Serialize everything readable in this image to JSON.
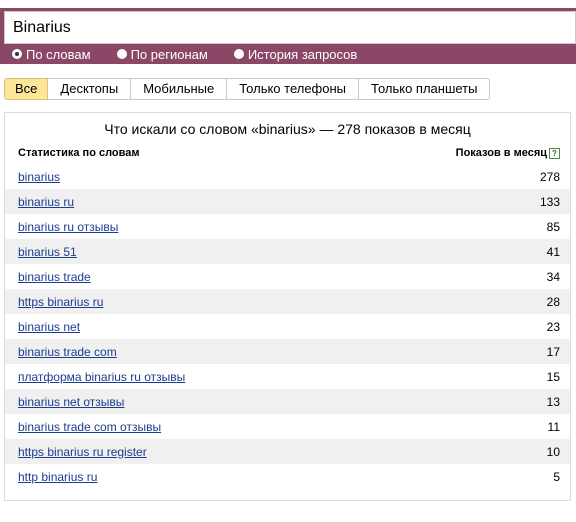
{
  "search": {
    "value": "Binarius"
  },
  "modes": [
    {
      "label": "По словам",
      "checked": true
    },
    {
      "label": "По регионам",
      "checked": false
    },
    {
      "label": "История запросов",
      "checked": false
    }
  ],
  "tabs": [
    "Все",
    "Десктопы",
    "Мобильные",
    "Только телефоны",
    "Только планшеты"
  ],
  "active_tab": "Все",
  "panel": {
    "title": "Что искали со словом «binarius» — 278 показов в месяц",
    "col_left": "Статистика по словам",
    "col_right": "Показов в месяц",
    "help": "?"
  },
  "rows": [
    {
      "phrase": "binarius",
      "count": "278"
    },
    {
      "phrase": "binarius ru",
      "count": "133"
    },
    {
      "phrase": "binarius ru отзывы",
      "count": "85"
    },
    {
      "phrase": "binarius 51",
      "count": "41"
    },
    {
      "phrase": "binarius trade",
      "count": "34"
    },
    {
      "phrase": "https binarius ru",
      "count": "28"
    },
    {
      "phrase": "binarius net",
      "count": "23"
    },
    {
      "phrase": "binarius trade com",
      "count": "17"
    },
    {
      "phrase": "платформа binarius ru отзывы",
      "count": "15"
    },
    {
      "phrase": "binarius net отзывы",
      "count": "13"
    },
    {
      "phrase": "binarius trade com отзывы",
      "count": "11"
    },
    {
      "phrase": "https binarius ru register",
      "count": "10"
    },
    {
      "phrase": "http binarius ru",
      "count": "5"
    }
  ],
  "colors": {
    "topbar": "#8b4866",
    "active_tab": "#fde69a",
    "link": "#1a3d8f",
    "row_shade": "#f0f0f0"
  }
}
